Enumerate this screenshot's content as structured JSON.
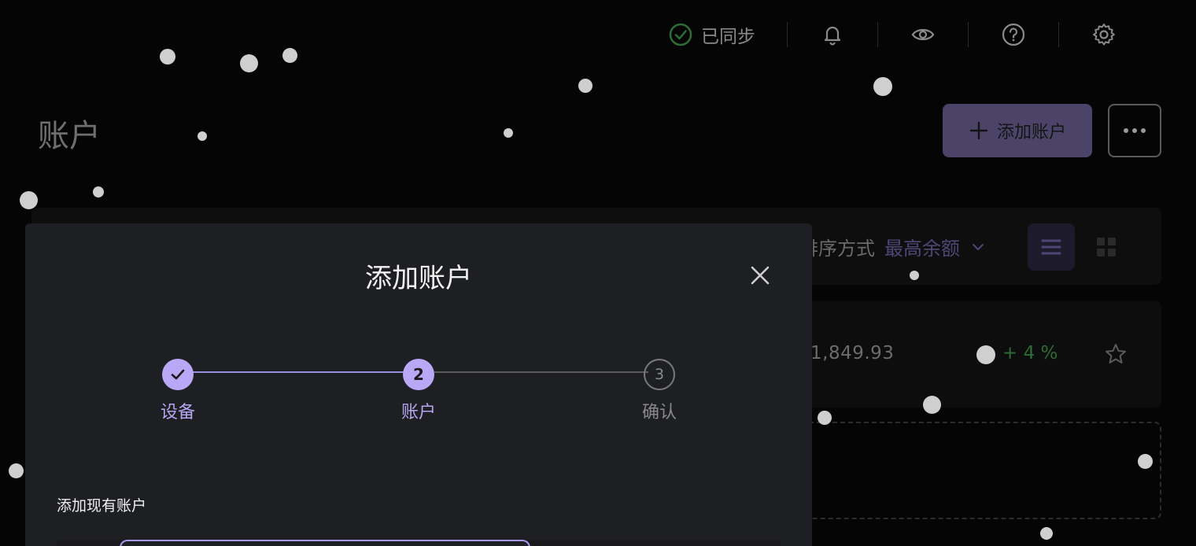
{
  "topbar": {
    "sync_status": "已同步",
    "icons": [
      "sync-check-icon",
      "bell-icon",
      "eye-icon",
      "help-icon",
      "gear-icon"
    ]
  },
  "page": {
    "title": "账户",
    "add_account_label": "添加账户"
  },
  "filter": {
    "sort_label": "排序方式",
    "sort_value": "最高余额"
  },
  "account_row": {
    "balance": "1,849.93",
    "change": "+ 4 %"
  },
  "modal": {
    "title": "添加账户",
    "steps": [
      {
        "label": "设备",
        "state": "done"
      },
      {
        "label": "账户",
        "number": "2",
        "state": "active"
      },
      {
        "label": "确认",
        "number": "3",
        "state": "pending"
      }
    ],
    "section_label": "添加现有账户"
  },
  "colors": {
    "accent": "#b9a8f6",
    "accent_dim": "#4b4468",
    "positive": "#2f6b34",
    "sync_ok": "#2f6b34",
    "modal_bg": "#1e1f22"
  }
}
